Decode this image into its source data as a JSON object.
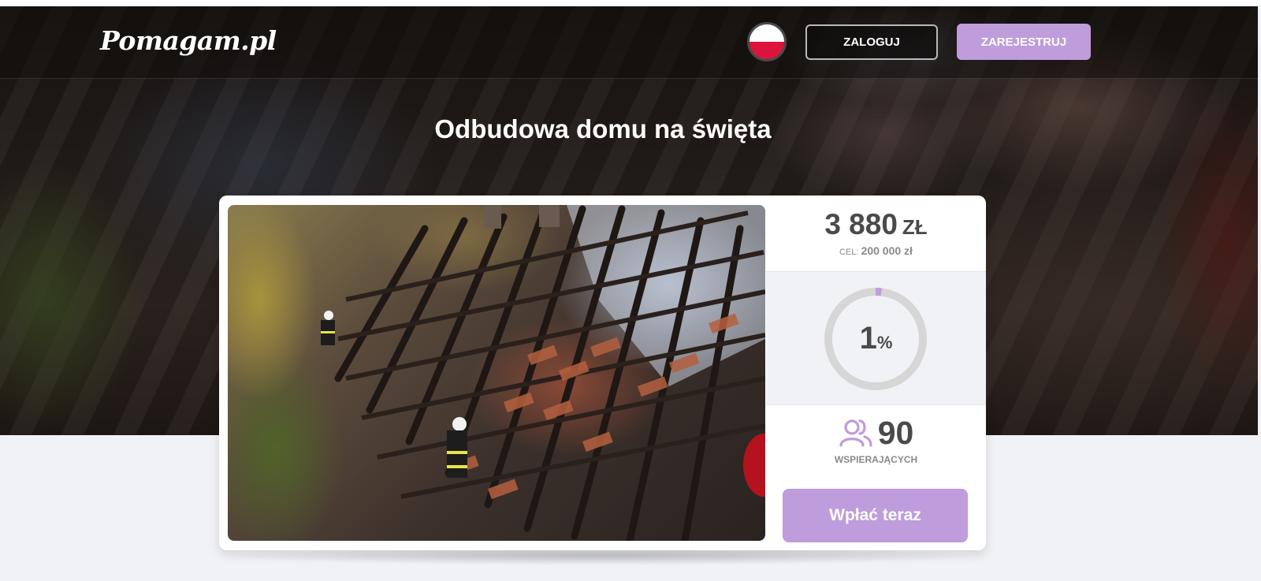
{
  "header": {
    "logo_text": "Pomagam.pl",
    "flag_icon": "poland-flag-icon",
    "login_label": "ZALOGUJ",
    "register_label": "ZAREJESTRUJ"
  },
  "campaign": {
    "title": "Odbudowa domu na święta",
    "photo_icon": "burnt-roof-photo"
  },
  "stats": {
    "amount_value": "3 880",
    "amount_currency": "ZŁ",
    "goal_label": "CEL:",
    "goal_value": "200 000 zł",
    "progress_percent_value": "1",
    "progress_percent_symbol": "%",
    "progress_fraction": 0.0194,
    "supporters_icon": "supporters-icon",
    "supporters_count": "90",
    "supporters_label": "WSPIERAJĄCYCH",
    "donate_label": "Wpłać teraz"
  },
  "colors": {
    "accent": "#bf9cdb",
    "text_dark": "#4a4a4a",
    "text_muted": "#8a8a8a",
    "page_bg": "#f1f2f6",
    "ring_track": "#d6d6d6"
  }
}
